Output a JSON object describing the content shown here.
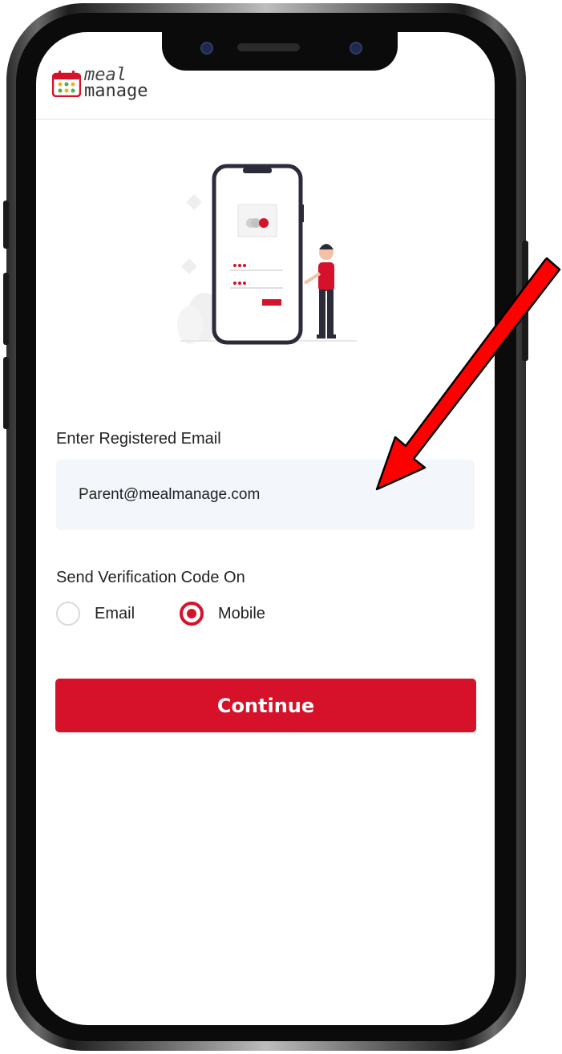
{
  "brand": {
    "logo_line1": "meal",
    "logo_line2": "manage",
    "accent_color": "#d6122b"
  },
  "form": {
    "email_label": "Enter Registered Email",
    "email_value": "Parent@mealmanage.com",
    "verify_label": "Send Verification Code On",
    "options": [
      {
        "label": "Email",
        "selected": false
      },
      {
        "label": "Mobile",
        "selected": true
      }
    ],
    "continue_label": "Continue"
  },
  "annotation": {
    "arrow_color": "#ff0000",
    "arrow_icon": "red-arrow-pointing-to-email-field"
  }
}
